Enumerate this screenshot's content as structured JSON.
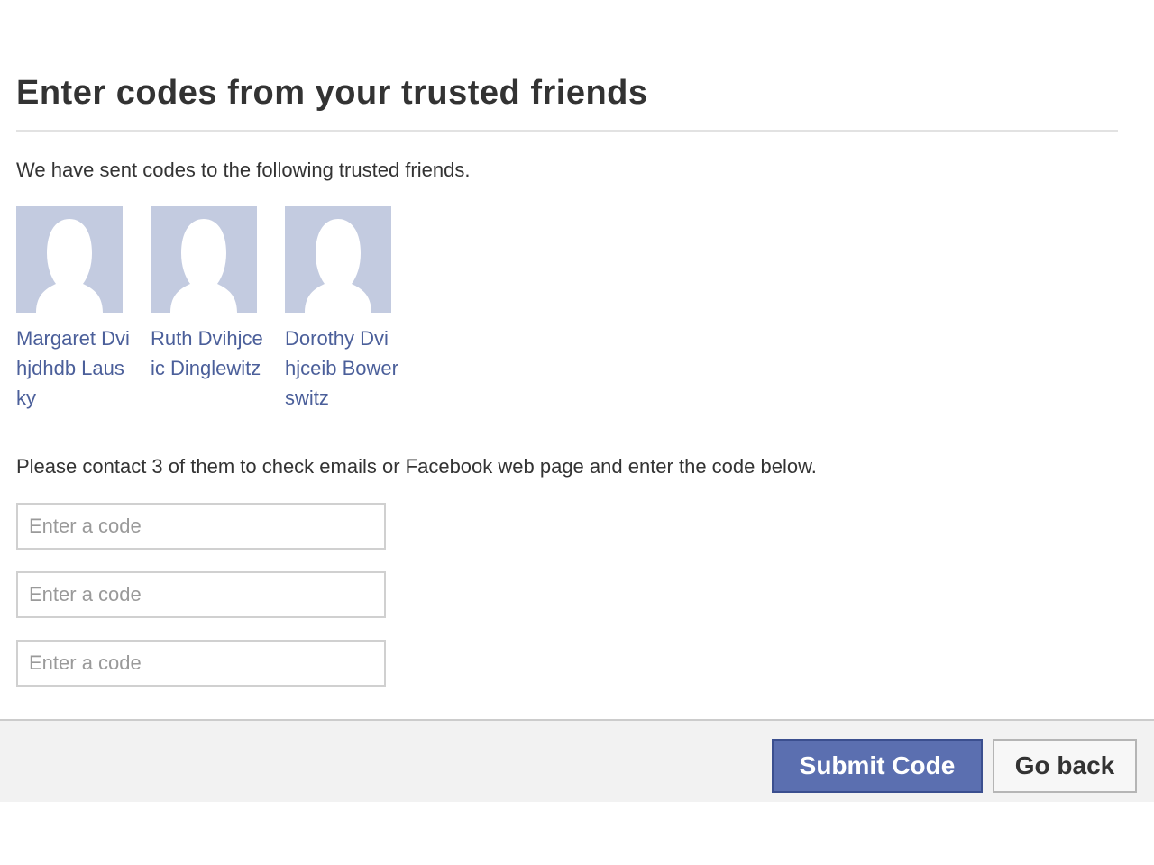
{
  "header": {
    "title": "Enter codes from your trusted friends"
  },
  "intro_text": "We have sent codes to the following trusted friends.",
  "friends": [
    {
      "name": "Margaret Dvihjdhdb Lausky"
    },
    {
      "name": "Ruth Dvihjceic Dinglewitz"
    },
    {
      "name": "Dorothy Dvihjceib Bowerswitz"
    }
  ],
  "instructions": "Please contact 3 of them to check emails or Facebook web page and enter the code below.",
  "code_inputs": [
    {
      "placeholder": "Enter a code",
      "value": ""
    },
    {
      "placeholder": "Enter a code",
      "value": ""
    },
    {
      "placeholder": "Enter a code",
      "value": ""
    }
  ],
  "footer": {
    "submit_label": "Submit Code",
    "back_label": "Go back"
  },
  "icons": {
    "avatar": "default-profile-silhouette-icon"
  },
  "colors": {
    "title_text": "#333333",
    "link_text": "#4b5f9a",
    "avatar_bg": "#c3cbe0",
    "submit_bg": "#5b6fb0",
    "footer_bg": "#f2f2f2"
  }
}
